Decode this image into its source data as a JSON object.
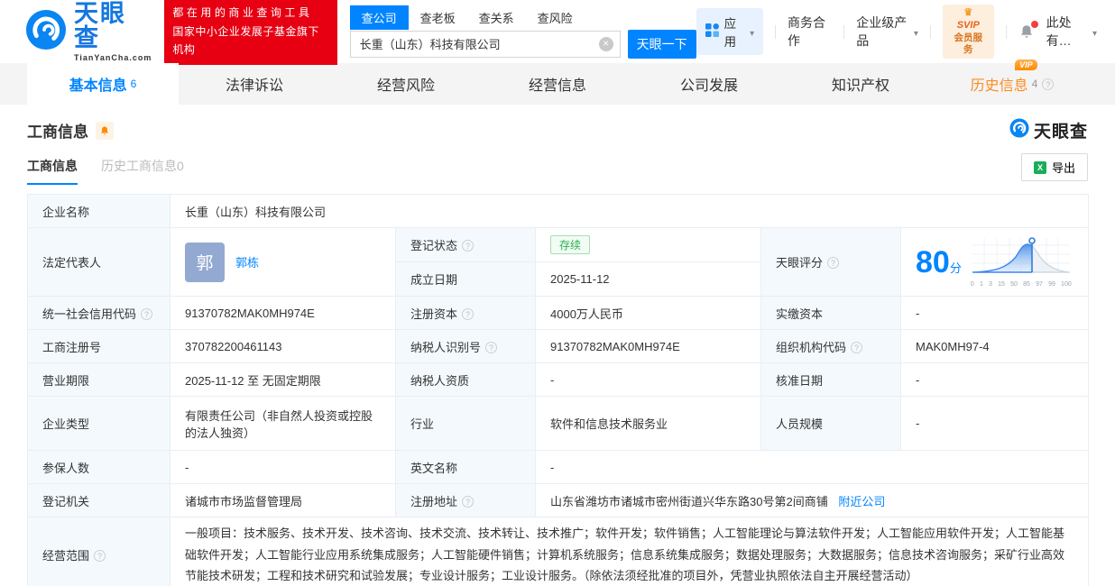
{
  "brand": {
    "name": "天眼查",
    "domain": "TianYanCha.com",
    "slogan1": "都在用的商业查询工具",
    "slogan2": "国家中小企业发展子基金旗下机构"
  },
  "search": {
    "tabs": [
      "查公司",
      "查老板",
      "查关系",
      "查风险"
    ],
    "value": "长重（山东）科技有限公司",
    "button": "天眼一下"
  },
  "header_right": {
    "apps": "应用",
    "cooperation": "商务合作",
    "enterprise": "企业级产品",
    "svip_top": "SVIP",
    "svip_bottom": "会员服务",
    "more": "此处有…"
  },
  "nav_tabs": [
    {
      "label": "基本信息",
      "count": "6"
    },
    {
      "label": "法律诉讼"
    },
    {
      "label": "经营风险"
    },
    {
      "label": "经营信息"
    },
    {
      "label": "公司发展"
    },
    {
      "label": "知识产权"
    },
    {
      "label": "历史信息",
      "count": "4",
      "vip": "VIP"
    }
  ],
  "section": {
    "title": "工商信息",
    "watermark": "天眼查",
    "subtab_current": "工商信息",
    "subtab_history": "历史工商信息0",
    "export": "导出"
  },
  "info": {
    "company_name_label": "企业名称",
    "company_name": "长重（山东）科技有限公司",
    "legal_rep_label": "法定代表人",
    "legal_rep_avatar": "郭",
    "legal_rep_name": "郭栋",
    "reg_status_label": "登记状态",
    "reg_status": "存续",
    "establish_label": "成立日期",
    "establish_date": "2025-11-12",
    "score_label": "天眼评分",
    "uscc_label": "统一社会信用代码",
    "uscc": "91370782MAK0MH974E",
    "reg_capital_label": "注册资本",
    "reg_capital": "4000万人民币",
    "paid_capital_label": "实缴资本",
    "paid_capital": "-",
    "reg_number_label": "工商注册号",
    "reg_number": "370782200461143",
    "taxpayer_id_label": "纳税人识别号",
    "taxpayer_id": "91370782MAK0MH974E",
    "org_code_label": "组织机构代码",
    "org_code": "MAK0MH97-4",
    "business_term_label": "营业期限",
    "business_term": "2025-11-12 至 无固定期限",
    "taxpayer_quality_label": "纳税人资质",
    "taxpayer_quality": "-",
    "approval_date_label": "核准日期",
    "approval_date": "-",
    "company_type_label": "企业类型",
    "company_type": "有限责任公司（非自然人投资或控股的法人独资）",
    "industry_label": "行业",
    "industry": "软件和信息技术服务业",
    "staff_size_label": "人员规模",
    "staff_size": "-",
    "insured_label": "参保人数",
    "insured": "-",
    "english_name_label": "英文名称",
    "english_name": "-",
    "reg_authority_label": "登记机关",
    "reg_authority": "诸城市市场监督管理局",
    "address_label": "注册地址",
    "address": "山东省潍坊市诸城市密州街道兴华东路30号第2间商铺",
    "nearby_link": "附近公司",
    "business_scope_label": "经营范围",
    "business_scope": "一般项目：技术服务、技术开发、技术咨询、技术交流、技术转让、技术推广；软件开发；软件销售；人工智能理论与算法软件开发；人工智能应用软件开发；人工智能基础软件开发；人工智能行业应用系统集成服务；人工智能硬件销售；计算机系统服务；信息系统集成服务；数据处理服务；大数据服务；信息技术咨询服务；采矿行业高效节能技术研发；工程和技术研究和试验发展；专业设计服务；工业设计服务。（除依法须经批准的项目外，凭营业执照依法自主开展经营活动）"
  },
  "score_chart": {
    "type": "area",
    "score": "80",
    "unit": "分",
    "ticks": [
      "0",
      "1",
      "3",
      "15",
      "50",
      "85",
      "97",
      "99",
      "100"
    ],
    "marker_value": 80,
    "curve_peak_tick": "50"
  },
  "colors": {
    "accent": "#0084ff",
    "badge_red": "#e60012",
    "vip_orange": "#ff8a00",
    "status_green": "#2bb24c",
    "label_cell_bg": "#f3f9fd"
  }
}
